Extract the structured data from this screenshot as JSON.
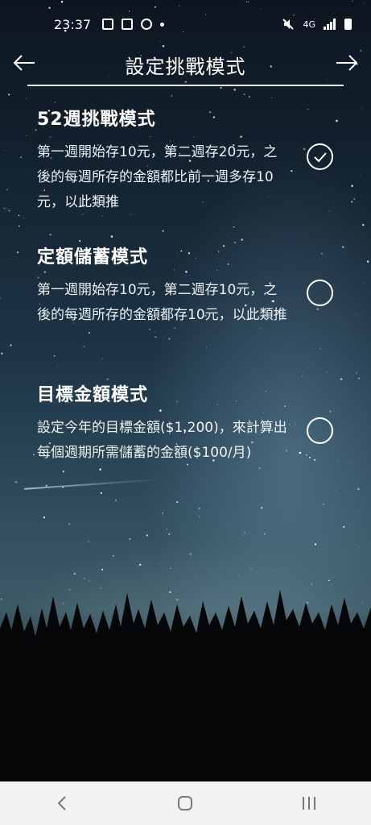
{
  "status_bar": {
    "time": "23:37",
    "network": "4G"
  },
  "header": {
    "title": "設定挑戰模式"
  },
  "options": [
    {
      "title": "52週挑戰模式",
      "description": "第一週開始存10元，第二週存20元，之後的每週所存的金額都比前一週多存10元，以此類推",
      "selected": true
    },
    {
      "title": "定額儲蓄模式",
      "description": "第一週開始存10元，第二週存10元，之後的每週所存的金額都存10元，以此類推",
      "selected": false
    },
    {
      "title": "目標金額模式",
      "description": "設定今年的目標金額($1,200)，來計算出每個週期所需儲蓄的金額($100/月)",
      "selected": false
    }
  ],
  "colors": {
    "text": "#ffffff",
    "nav_bar": "#f2f2f2",
    "nav_icon": "#7a7a7a"
  }
}
